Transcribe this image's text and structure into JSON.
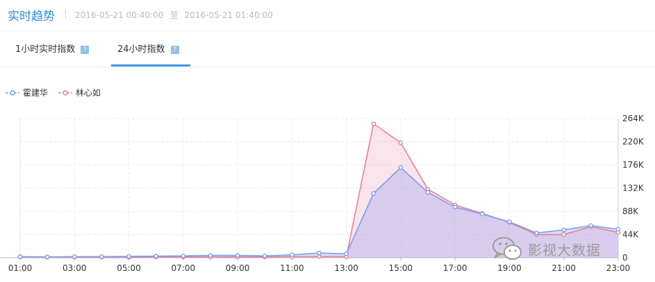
{
  "header": {
    "title": "实时趋势",
    "range_start": "2016-05-21 00:40:00",
    "range_to": "至",
    "range_end": "2016-05-21 01:40:00"
  },
  "tabs": [
    {
      "label": "1小时实时指数",
      "help": "?"
    },
    {
      "label": "24小时指数",
      "help": "?",
      "active": true
    }
  ],
  "watermark": "影视大数据",
  "chart_data": {
    "type": "area",
    "title": "",
    "xlabel": "",
    "ylabel": "",
    "legend_position": "top-left",
    "grid": true,
    "x": [
      "01:00",
      "02:00",
      "03:00",
      "04:00",
      "05:00",
      "06:00",
      "07:00",
      "08:00",
      "09:00",
      "10:00",
      "11:00",
      "12:00",
      "13:00",
      "14:00",
      "15:00",
      "16:00",
      "17:00",
      "18:00",
      "19:00",
      "20:00",
      "21:00",
      "22:00",
      "23:00"
    ],
    "x_tick_labels": [
      "01:00",
      "03:00",
      "05:00",
      "07:00",
      "09:00",
      "11:00",
      "13:00",
      "15:00",
      "17:00",
      "19:00",
      "21:00",
      "23:00"
    ],
    "y_tick_labels": [
      "0",
      "44K",
      "88K",
      "132K",
      "176K",
      "220K",
      "264K"
    ],
    "ylim": [
      0,
      264000
    ],
    "series": [
      {
        "name": "霍建华",
        "color": "#7a9ff0",
        "values": [
          2000,
          1500,
          2000,
          2000,
          2500,
          3000,
          3500,
          4500,
          4500,
          3500,
          5500,
          9000,
          7500,
          122000,
          171000,
          124000,
          96000,
          83000,
          68000,
          47000,
          53000,
          61000,
          54000
        ]
      },
      {
        "name": "林心如",
        "color": "#e77f98",
        "values": [
          1500,
          1000,
          1000,
          1000,
          1000,
          1500,
          1500,
          1500,
          1500,
          1500,
          2000,
          2000,
          2000,
          254000,
          218000,
          130000,
          100000,
          84000,
          67000,
          44000,
          44000,
          59000,
          48000
        ]
      }
    ]
  }
}
